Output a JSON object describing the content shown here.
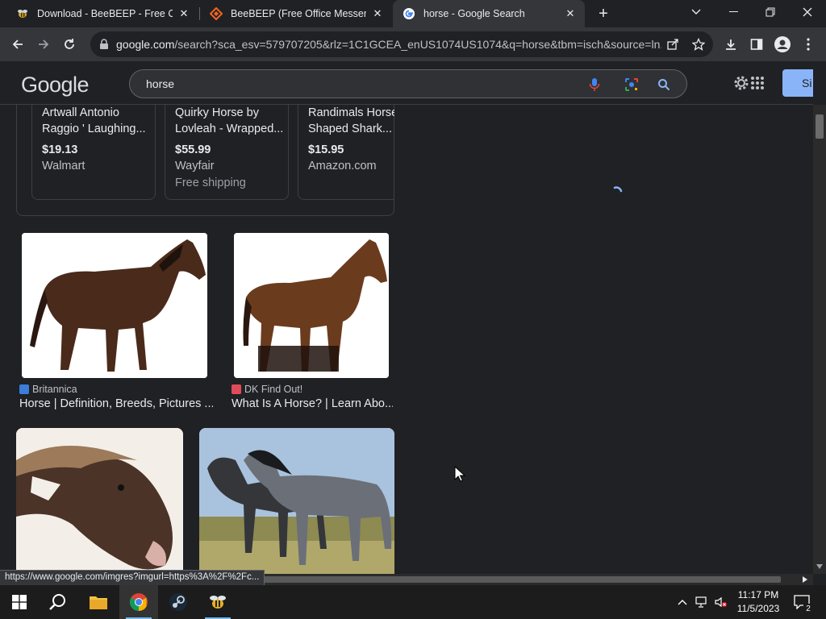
{
  "browser": {
    "tabs": [
      {
        "title": "Download - BeeBEEP - Free Offic",
        "icon": "beebeep-icon"
      },
      {
        "title": "BeeBEEP (Free Office Messenger",
        "icon": "sourceforge-icon"
      },
      {
        "title": "horse - Google Search",
        "icon": "google-icon",
        "active": true
      }
    ],
    "url_host": "google.com",
    "url_rest": "/search?sca_esv=579707205&rlz=1C1GCEA_enUS1074US1074&q=horse&tbm=isch&source=ln..."
  },
  "google": {
    "logo": "Google",
    "query": "horse",
    "signin_label": "Si"
  },
  "shopping": [
    {
      "name": "Artwall Antonio Raggio ' Laughing...",
      "price": "$19.13",
      "store": "Walmart",
      "shipping": ""
    },
    {
      "name": "Quirky Horse by Lovleah - Wrapped...",
      "price": "$55.99",
      "store": "Wayfair",
      "shipping": "Free shipping"
    },
    {
      "name": "Randimals Horse Shaped Shark...",
      "price": "$15.95",
      "store": "Amazon.com",
      "shipping": ""
    }
  ],
  "results": [
    {
      "source": "Britannica",
      "caption": "Horse | Definition, Breeds, Pictures ..."
    },
    {
      "source": "DK Find Out!",
      "caption": "What Is A Horse? | Learn Abo..."
    }
  ],
  "status_url": "https://www.google.com/imgres?imgurl=https%3A%2F%2Fc...",
  "taskbar": {
    "time": "11:17 PM",
    "date": "11/5/2023",
    "notifications": "2"
  },
  "colors": {
    "accent": "#8ab4f8",
    "page_bg": "#202124",
    "toolbar_bg": "#35363a"
  }
}
